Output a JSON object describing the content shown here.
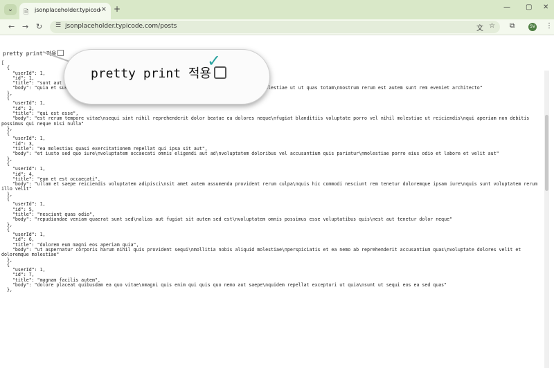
{
  "browser": {
    "tab_title": "jsonplaceholder.typicode.com",
    "url": "jsonplaceholder.typicode.com/posts",
    "profile_initials": "SV",
    "tab_close": "×",
    "new_tab": "+",
    "window_minimize": "—",
    "window_maximize": "▢",
    "window_close": "✕"
  },
  "page": {
    "pretty_print_label": "pretty print 적용",
    "zoom_label": "pretty print 적용",
    "json_text": "[\n  {\n    \"userId\": 1,\n    \"id\": 1,\n    \"title\": \"sunt aut facere repellat provident occaecati excepturi optio reprehenderit\",\n    \"body\": \"quia et suscipit\\nsuscipit recusandae consequuntur expedita et cum\\nreprehenderit molestiae ut ut quas totam\\nnostrum rerum est autem sunt rem eveniet architecto\"\n  },\n  {\n    \"userId\": 1,\n    \"id\": 2,\n    \"title\": \"qui est esse\",\n    \"body\": \"est rerum tempore vitae\\nsequi sint nihil reprehenderit dolor beatae ea dolores neque\\nfugiat blanditiis voluptate porro vel nihil molestiae ut reiciendis\\nqui aperiam non debitis possimus qui neque nisi nulla\"\n  },\n  {\n    \"userId\": 1,\n    \"id\": 3,\n    \"title\": \"ea molestias quasi exercitationem repellat qui ipsa sit aut\",\n    \"body\": \"et iusto sed quo iure\\nvoluptatem occaecati omnis eligendi aut ad\\nvoluptatem doloribus vel accusantium quis pariatur\\nmolestiae porro eius odio et labore et velit aut\"\n  },\n  {\n    \"userId\": 1,\n    \"id\": 4,\n    \"title\": \"eum et est occaecati\",\n    \"body\": \"ullam et saepe reiciendis voluptatem adipisci\\nsit amet autem assumenda provident rerum culpa\\nquis hic commodi nesciunt rem tenetur doloremque ipsam iure\\nquis sunt voluptatem rerum illo velit\"\n  },\n  {\n    \"userId\": 1,\n    \"id\": 5,\n    \"title\": \"nesciunt quas odio\",\n    \"body\": \"repudiandae veniam quaerat sunt sed\\nalias aut fugiat sit autem sed est\\nvoluptatem omnis possimus esse voluptatibus quis\\nest aut tenetur dolor neque\"\n  },\n  {\n    \"userId\": 1,\n    \"id\": 6,\n    \"title\": \"dolorem eum magni eos aperiam quia\",\n    \"body\": \"ut aspernatur corporis harum nihil quis provident sequi\\nmollitia nobis aliquid molestiae\\nperspiciatis et ea nemo ab reprehenderit accusantium quas\\nvoluptate dolores velit et doloremque molestiae\"\n  },\n  {\n    \"userId\": 1,\n    \"id\": 7,\n    \"title\": \"magnam facilis autem\",\n    \"body\": \"dolore placeat quibusdam ea quo vitae\\nmagni quis enim qui quis quo nemo aut saepe\\nquidem repellat excepturi ut quia\\nsunt ut sequi eos ea sed quas\"\n  },"
  },
  "icons": {
    "back": "←",
    "forward": "→",
    "reload": "↻",
    "tab_search": "⌄",
    "translate": "文",
    "bookmark": "☆",
    "extensions": "⧉",
    "menu": "⋮"
  }
}
